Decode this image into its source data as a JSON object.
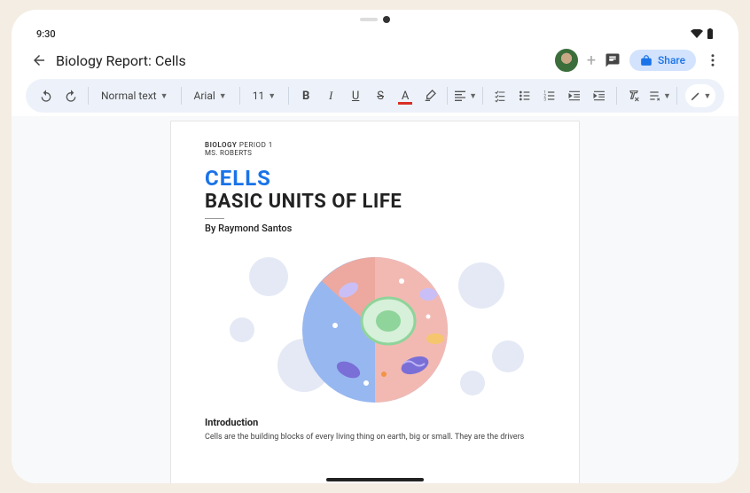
{
  "status": {
    "time": "9:30"
  },
  "titlebar": {
    "doc_title": "Biology Report: Cells",
    "share_label": "Share"
  },
  "toolbar": {
    "style_select": "Normal text",
    "font_select": "Arial",
    "size_select": "11"
  },
  "document": {
    "course_label": "BIOLOGY",
    "period_label": "PERIOD 1",
    "teacher": "MS. ROBERTS",
    "title": "CELLS",
    "subtitle": "BASIC UNITS OF LIFE",
    "byline": "By Raymond Santos",
    "section_heading": "Introduction",
    "body_preview": "Cells are the building blocks of every living thing on earth, big or small. They are the drivers"
  }
}
